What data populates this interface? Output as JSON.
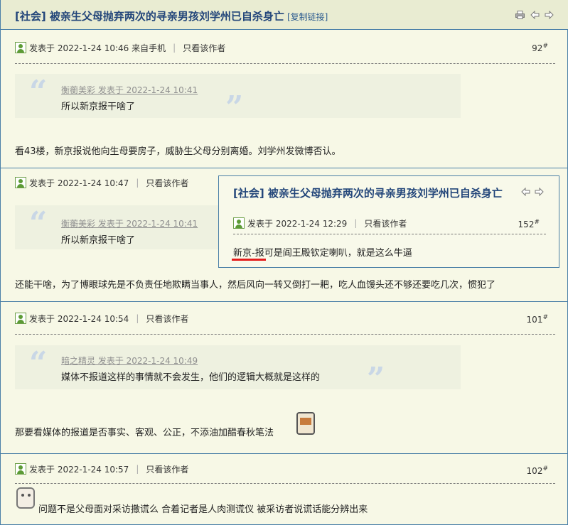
{
  "header": {
    "title": "[社会] 被亲生父母抛弃两次的寻亲男孩刘学州已自杀身亡",
    "copy_link": "[复制链接]",
    "icons": [
      "print-icon",
      "prev-icon",
      "next-icon"
    ]
  },
  "posts": [
    {
      "meta": "发表于 2022-1-24 10:46 来自手机",
      "only_author": "只看该作者",
      "floor": "92",
      "quote_author": "衡蘅美彩 发表于 2022-1-24 10:41",
      "quote_text": "所以新京报干啥了",
      "text": "看43楼，新京报说他向生母要房子，威胁生父母分别离婚。刘学州发微博否认。"
    },
    {
      "meta": "发表于 2022-1-24 10:47",
      "only_author": "只看该作者",
      "quote_author": "衡蘅美彩 发表于 2022-1-24 10:41",
      "quote_text": "所以新京报干啥了",
      "text": "还能干啥，为了博眼球先是不负责任地欺瞒当事人，然后风向一转又倒打一耙，吃人血馒头还不够还要吃几次，惯犯了"
    },
    {
      "meta": "发表于 2022-1-24 10:54",
      "only_author": "只看该作者",
      "floor": "101",
      "quote_author": "暗之精灵 发表于 2022-1-24 10:49",
      "quote_text": "媒体不报道这样的事情就不会发生，他们的逻辑大概就是这样的",
      "text": "那要看媒体的报道是否事实、客观、公正，不添油加醋春秋笔法"
    },
    {
      "meta": "发表于 2022-1-24 10:57",
      "only_author": "只看该作者",
      "floor": "102",
      "text": "问题不是父母面对采访撒谎么  合着记者是人肉测谎仪  被采访者说谎话能分辨出来"
    }
  ],
  "popup": {
    "title": "[社会] 被亲生父母抛弃两次的寻亲男孩刘学州已自杀身亡",
    "meta": "发表于 2022-1-24 12:29",
    "only_author": "只看该作者",
    "floor": "152",
    "text": "新京-报可是阎王殿钦定喇叭，就是这么牛逼"
  },
  "floor_mark": "#",
  "quote_marks": {
    "open": "“",
    "close": "”"
  },
  "colors": {
    "accent": "#23467a",
    "border": "#4a7fa7",
    "highlight": "#e41c1c"
  }
}
